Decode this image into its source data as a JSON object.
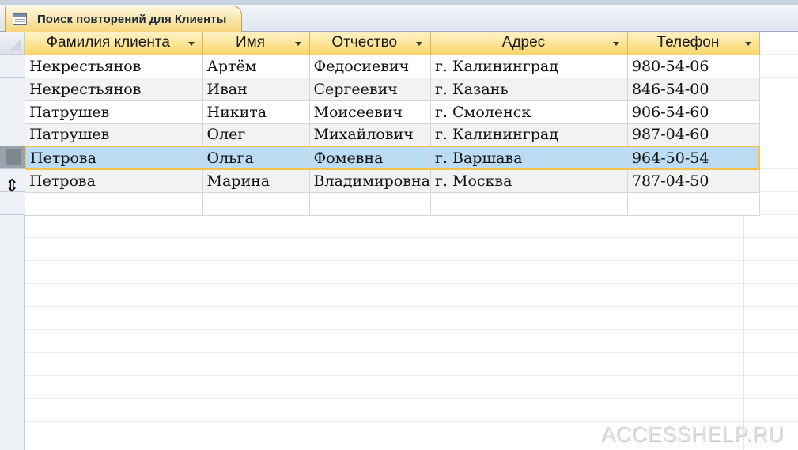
{
  "tab": {
    "title": "Поиск повторений для Клиенты",
    "icon": "query-icon"
  },
  "columns": [
    {
      "label": "Фамилия клиента"
    },
    {
      "label": "Имя"
    },
    {
      "label": "Отчество"
    },
    {
      "label": "Адрес"
    },
    {
      "label": "Телефон"
    }
  ],
  "rows": [
    [
      "Некрестьянов",
      "Артём",
      "Федосиевич",
      "г. Калининград",
      "980-54-06"
    ],
    [
      "Некрестьянов",
      "Иван",
      "Сергеевич",
      "г. Казань",
      "846-54-00"
    ],
    [
      "Патрушев",
      "Никита",
      "Моисеевич",
      "г. Смоленск",
      "906-54-60"
    ],
    [
      "Патрушев",
      "Олег",
      "Михайлович",
      "г. Калининград",
      "987-04-60"
    ],
    [
      "Петрова",
      "Ольга",
      "Фомевна",
      "г. Варшава",
      "964-50-54"
    ],
    [
      "Петрова",
      "Марина",
      "Владимировна",
      "г. Москва",
      "787-04-50"
    ]
  ],
  "selected_row_index": 4,
  "new_row_marker": "*",
  "row_cursor_glyph": "⇕",
  "watermark": "ACCESSHELP.RU",
  "colors": {
    "header_gradient_top": "#fff3c9",
    "header_gradient_bottom": "#fbd76a",
    "selected_row": "#bcdcf4",
    "selection_border": "#f6c24a"
  }
}
